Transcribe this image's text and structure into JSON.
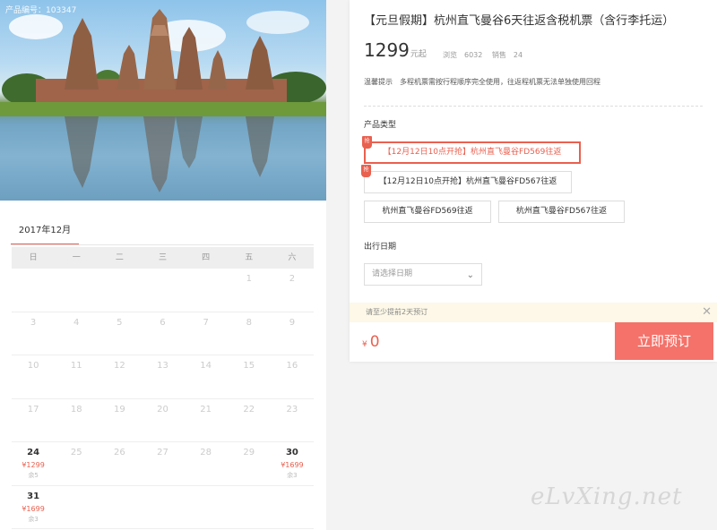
{
  "hero": {
    "product_no": "产品编号：103347"
  },
  "calendar": {
    "month": "2017年12月",
    "weekdays": [
      "日",
      "一",
      "二",
      "三",
      "四",
      "五",
      "六"
    ],
    "rows": [
      [
        {
          "d": ""
        },
        {
          "d": ""
        },
        {
          "d": ""
        },
        {
          "d": ""
        },
        {
          "d": ""
        },
        {
          "d": "1"
        },
        {
          "d": "2"
        }
      ],
      [
        {
          "d": "3"
        },
        {
          "d": "4"
        },
        {
          "d": "5"
        },
        {
          "d": "6"
        },
        {
          "d": "7"
        },
        {
          "d": "8"
        },
        {
          "d": "9"
        }
      ],
      [
        {
          "d": "10"
        },
        {
          "d": "11"
        },
        {
          "d": "12"
        },
        {
          "d": "13"
        },
        {
          "d": "14"
        },
        {
          "d": "15"
        },
        {
          "d": "16"
        }
      ],
      [
        {
          "d": "17"
        },
        {
          "d": "18"
        },
        {
          "d": "19"
        },
        {
          "d": "20"
        },
        {
          "d": "21"
        },
        {
          "d": "22"
        },
        {
          "d": "23"
        }
      ],
      [
        {
          "d": "24",
          "p": "¥1299",
          "s": "余5"
        },
        {
          "d": "25"
        },
        {
          "d": "26"
        },
        {
          "d": "27"
        },
        {
          "d": "28"
        },
        {
          "d": "29"
        },
        {
          "d": "30",
          "p": "¥1699",
          "s": "余3"
        }
      ],
      [
        {
          "d": "31",
          "p": "¥1699",
          "s": "余3"
        },
        {
          "d": ""
        },
        {
          "d": ""
        },
        {
          "d": ""
        },
        {
          "d": ""
        },
        {
          "d": ""
        },
        {
          "d": ""
        }
      ]
    ]
  },
  "product": {
    "title": "【元旦假期】杭州直飞曼谷6天往返含税机票（含行李托运）",
    "price": "1299",
    "price_unit": "元起",
    "views_label": "浏览",
    "views": "6032",
    "sales_label": "销售",
    "sales": "24",
    "tip_label": "温馨提示",
    "tip_text": "多程机票需按行程顺序完全使用，往返程机票无法单独使用回程"
  },
  "type_section": {
    "label": "产品类型",
    "flag": "抢",
    "options": [
      "【12月12日10点开抢】杭州直飞曼谷FD569往返",
      "【12月12日10点开抢】杭州直飞曼谷FD567往返",
      "杭州直飞曼谷FD569往返",
      "杭州直飞曼谷FD567往返"
    ]
  },
  "date_section": {
    "label": "出行日期",
    "placeholder": "请选择日期"
  },
  "notice": {
    "text": "请至少提前2天预订",
    "close": "✕"
  },
  "order": {
    "currency": "¥",
    "total": "0",
    "book_label": "立即预订"
  },
  "watermark": "eLvXing.net",
  "colors": {
    "accent": "#e9604f",
    "book_button": "#f4726a",
    "notice_bg": "#fdf8e7"
  }
}
